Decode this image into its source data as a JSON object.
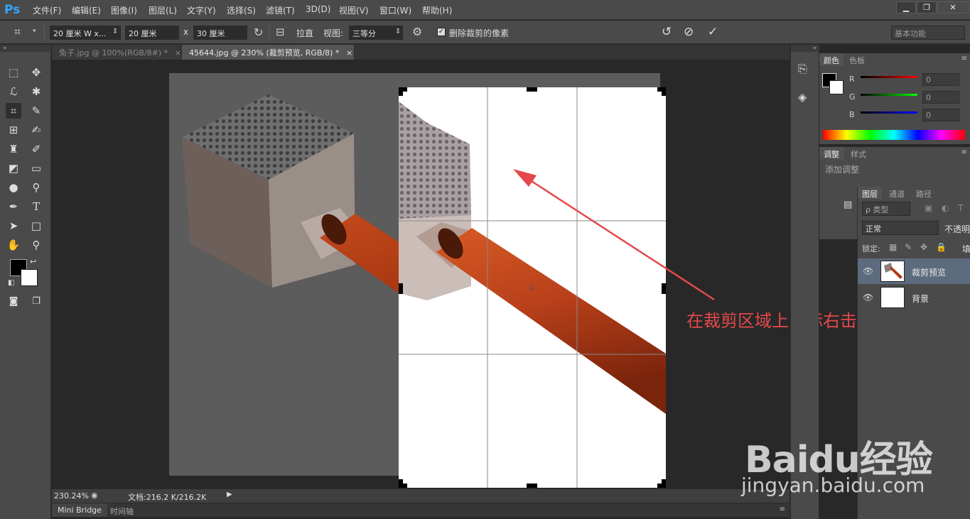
{
  "app": {
    "logo": "Ps"
  },
  "menu": [
    "文件(F)",
    "编辑(E)",
    "图像(I)",
    "图层(L)",
    "文字(Y)",
    "选择(S)",
    "滤镜(T)",
    "3D(D)",
    "视图(V)",
    "窗口(W)",
    "帮助(H)"
  ],
  "window_buttons": {
    "minimize": "▁",
    "restore": "❐",
    "close": "✕"
  },
  "options": {
    "ratio": "20 厘米 W x...",
    "width": "20 厘米",
    "times": "x",
    "height": "30 厘米",
    "straighten": "拉直",
    "view_label": "视图:",
    "view_value": "三等分",
    "delete_pixels": "删除裁剪的像素",
    "delete_pixels_checked": true,
    "workspace": "基本功能"
  },
  "tabs": [
    {
      "label": "兔子.jpg @ 100%(RGB/8#) *",
      "close": "×"
    },
    {
      "label": "45644.jpg @ 230% (裁剪预览, RGB/8) *",
      "close": "×"
    }
  ],
  "status": {
    "zoom": "230.24%",
    "doc": "文档:216.2 K/216.2K"
  },
  "bottom_tabs": [
    "Mini Bridge",
    "时间轴"
  ],
  "color_panel": {
    "tabs": [
      "颜色",
      "色板"
    ],
    "channels": [
      {
        "label": "R",
        "value": "0",
        "color": "#ff0000"
      },
      {
        "label": "G",
        "value": "0",
        "color": "#00ff00"
      },
      {
        "label": "B",
        "value": "0",
        "color": "#0000ff"
      }
    ]
  },
  "adjust_panel": {
    "tabs": [
      "调整",
      "样式"
    ],
    "title": "添加调整"
  },
  "layers_panel": {
    "tabs": [
      "图层",
      "通道",
      "路径"
    ],
    "filter": "ρ 类型",
    "blend": "正常",
    "opacity_label": "不透明",
    "lock_label": "锁定:",
    "fill_label": "填",
    "layers": [
      {
        "name": "裁剪预览",
        "selected": true
      },
      {
        "name": "背景",
        "selected": false
      }
    ]
  },
  "annotation": "在裁剪区域上鼠标右击",
  "watermark": {
    "logo": "Baidu经验",
    "url": "jingyan.baidu.com"
  }
}
